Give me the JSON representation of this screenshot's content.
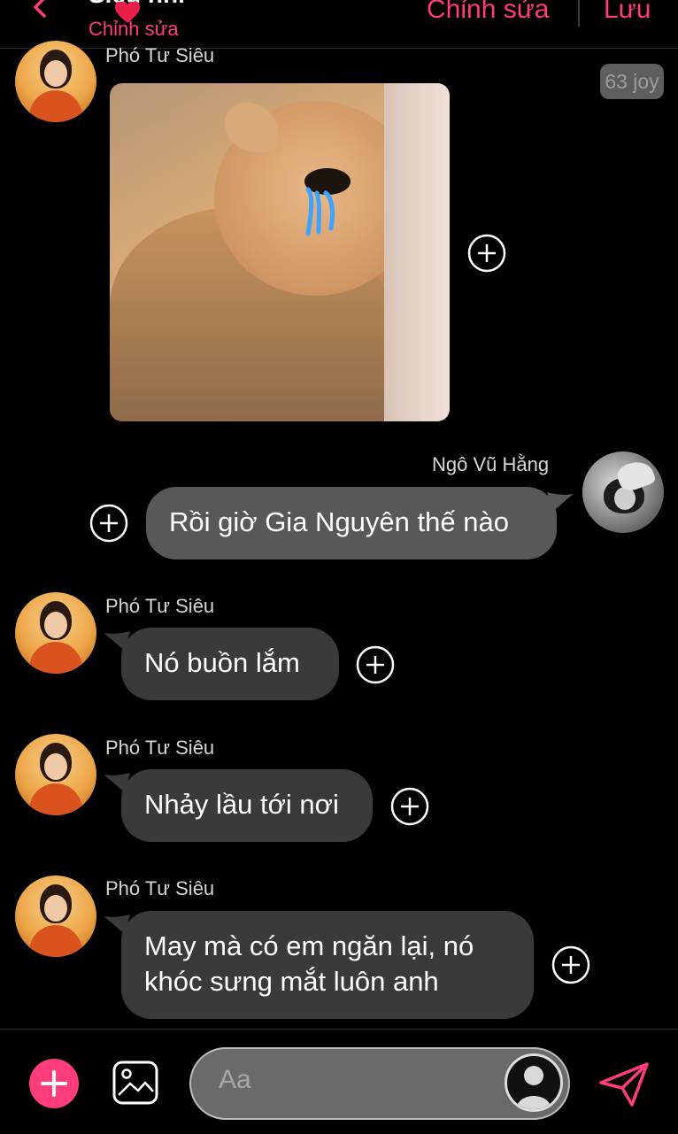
{
  "header": {
    "title": "Siêu nhí",
    "subtitle": "Chỉnh sửa",
    "edit_label": "Chỉnh sửa",
    "save_label": "Lưu",
    "accent_color": "#ff3d78"
  },
  "messages": [
    {
      "sender": "Phó Tư Siêu",
      "type": "image",
      "image_desc": "crying cat sticker",
      "reaction_badge": "63 joy"
    },
    {
      "sender": "Ngô Vũ Hằng",
      "type": "text",
      "text": "Rồi giờ Gia Nguyên thế nào",
      "outgoing": true
    },
    {
      "sender": "Phó Tư Siêu",
      "type": "text",
      "text": "Nó buồn lắm"
    },
    {
      "sender": "Phó Tư Siêu",
      "type": "text",
      "text": "Nhảy lầu tới nơi"
    },
    {
      "sender": "Phó Tư Siêu",
      "type": "text",
      "lines": [
        "May mà có em ngăn lại, nó",
        "khóc sưng mắt luôn anh"
      ]
    }
  ],
  "input": {
    "placeholder": "Aa"
  },
  "icons": [
    "back-icon",
    "heart-icon",
    "plus-icon",
    "add-icon",
    "gallery-icon",
    "sticker-icon",
    "send-icon"
  ]
}
